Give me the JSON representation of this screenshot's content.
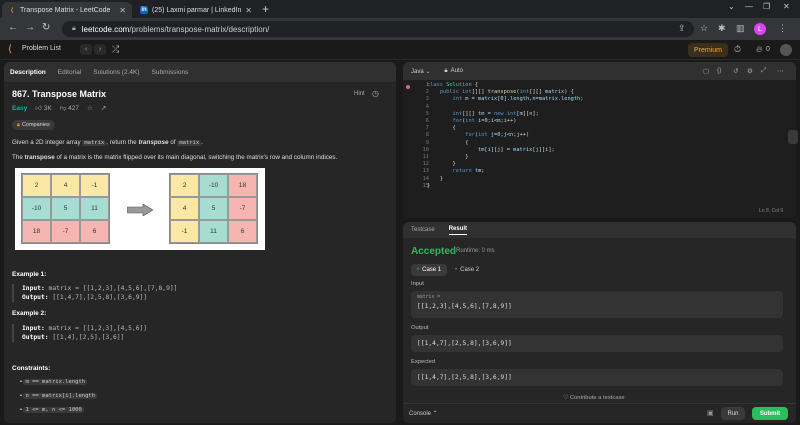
{
  "browser": {
    "tabs": [
      {
        "label": "Transpose Matrix - LeetCode",
        "active": true
      },
      {
        "label": "(25) Laxmi parmar | LinkedIn",
        "active": false
      }
    ],
    "url_host": "leetcode.com",
    "url_path": "/problems/transpose-matrix/description/",
    "profile_initial": "L"
  },
  "lcnav": {
    "problem_list": "Problem List",
    "premium": "Premium",
    "fire_count": "0"
  },
  "left": {
    "tabs": [
      "Description",
      "Editorial",
      "Solutions (2.4K)",
      "Submissions"
    ],
    "title": "867. Transpose Matrix",
    "hint": "Hint",
    "difficulty": "Easy",
    "likes": "3K",
    "dislikes": "427",
    "companies": "Companies",
    "desc_pre": "Given a 2D integer array ",
    "desc_code": "matrix",
    "desc_mid": ", return the ",
    "desc_em": "transpose",
    "desc_of": " of ",
    "desc_code2": "matrix",
    "desc_end": ".",
    "def_bold": "transpose",
    "def_pre": "The ",
    "def_rest": " of a matrix is the matrix flipped over its main diagonal, switching the matrix's row and column indices.",
    "matrix_a": [
      "2",
      "4",
      "-1",
      "-10",
      "5",
      "11",
      "18",
      "-7",
      "6"
    ],
    "matrix_b": [
      "2",
      "-10",
      "18",
      "4",
      "5",
      "-7",
      "-1",
      "11",
      "6"
    ],
    "example1_title": "Example 1:",
    "example1_input_label": "Input:",
    "example1_input": "matrix = [[1,2,3],[4,5,6],[7,8,9]]",
    "example1_output_label": "Output:",
    "example1_output": "[[1,4,7],[2,5,8],[3,6,9]]",
    "example2_title": "Example 2:",
    "example2_input_label": "Input:",
    "example2_input": "matrix = [[1,2,3],[4,5,6]]",
    "example2_output_label": "Output:",
    "example2_output": "[[1,4],[2,5],[3,6]]",
    "constraints_title": "Constraints:",
    "constraints": [
      "m == matrix.length",
      "n == matrix[i].length",
      "1 <= m, n <= 1000"
    ]
  },
  "editor": {
    "language": "Java",
    "mode": "Auto",
    "line_numbers": [
      "1",
      "2",
      "3",
      "4",
      "5",
      "6",
      "7",
      "8",
      "9",
      "10",
      "11",
      "12",
      "13",
      "14",
      "15"
    ],
    "cursor": "Ln 8, Col 9"
  },
  "result": {
    "tabs": [
      "Testcase",
      "Result"
    ],
    "status": "Accepted",
    "runtime": "Runtime: 0 ms",
    "case1": "Case 1",
    "case2": "Case 2",
    "input_label": "Input",
    "input_sub": "matrix =",
    "input_value": "[[1,2,3],[4,5,6],[7,8,9]]",
    "output_label": "Output",
    "output_value": "[[1,4,7],[2,5,8],[3,6,9]]",
    "expected_label": "Expected",
    "expected_value": "[[1,4,7],[2,5,8],[3,6,9]]",
    "contribute": "Contribute a testcase",
    "console": "Console",
    "run": "Run",
    "submit": "Submit"
  },
  "colors": {
    "accent": "#ffa116",
    "easy": "#00b8a3",
    "accepted": "#2cbb5d"
  }
}
